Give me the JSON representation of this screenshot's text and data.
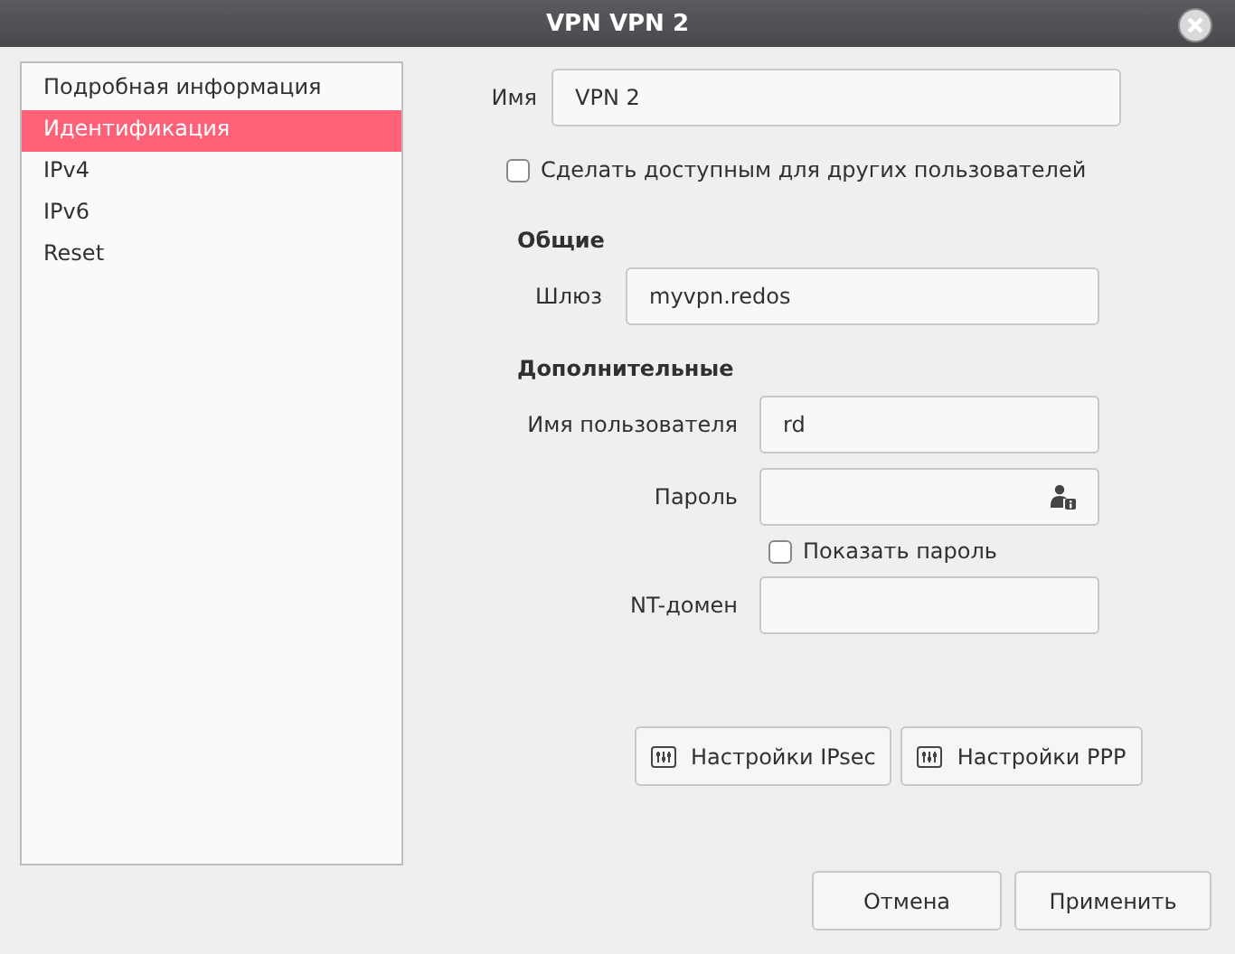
{
  "window": {
    "title": "VPN VPN 2"
  },
  "sidebar": {
    "items": [
      {
        "label": "Подробная информация",
        "selected": false
      },
      {
        "label": "Идентификация",
        "selected": true
      },
      {
        "label": "IPv4",
        "selected": false
      },
      {
        "label": "IPv6",
        "selected": false
      },
      {
        "label": "Reset",
        "selected": false
      }
    ]
  },
  "name_field": {
    "label": "Имя",
    "value": "VPN 2"
  },
  "share_checkbox": {
    "label": "Сделать доступным для других пользователей",
    "checked": false
  },
  "general": {
    "heading": "Общие",
    "gateway": {
      "label": "Шлюз",
      "value": "myvpn.redos"
    }
  },
  "additional": {
    "heading": "Дополнительные",
    "username": {
      "label": "Имя пользователя",
      "value": "rd"
    },
    "password": {
      "label": "Пароль"
    },
    "show_password": {
      "label": "Показать пароль",
      "checked": false
    },
    "nt_domain": {
      "label": "NT-домен"
    }
  },
  "settings_buttons": [
    {
      "label": "Настройки IPsec"
    },
    {
      "label": "Настройки PPP"
    }
  ],
  "footer_buttons": [
    {
      "label": "Отмена"
    },
    {
      "label": "Применить"
    }
  ]
}
